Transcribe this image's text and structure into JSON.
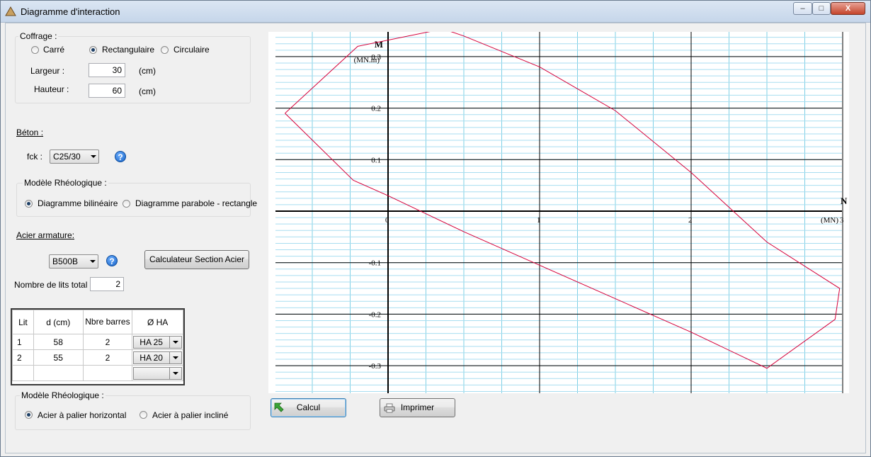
{
  "window": {
    "title": "Diagramme d'interaction",
    "controls": {
      "minimize": "–",
      "maximize": "□",
      "close": "X"
    }
  },
  "coffrage": {
    "legend": "Coffrage :",
    "shapes": [
      {
        "label": "Carré",
        "selected": false
      },
      {
        "label": "Rectangulaire",
        "selected": true
      },
      {
        "label": "Circulaire",
        "selected": false
      }
    ],
    "largeur": {
      "label": "Largeur :",
      "value": "30",
      "unit": "(cm)"
    },
    "hauteur": {
      "label": "Hauteur :",
      "value": "60",
      "unit": "(cm)"
    }
  },
  "beton": {
    "heading": "Béton :",
    "fck_label": "fck :",
    "fck_value": "C25/30",
    "help_icon": "?"
  },
  "modele_beton": {
    "legend": "Modèle Rhéologique :",
    "options": [
      {
        "label": "Diagramme bilinéaire",
        "selected": true
      },
      {
        "label": "Diagramme parabole - rectangle",
        "selected": false
      }
    ]
  },
  "acier": {
    "heading": "Acier armature:",
    "grade": "B500B",
    "help_icon": "?",
    "calc_button": "Calculateur Section Acier",
    "nb_lits_label": "Nombre de lits total :",
    "nb_lits_value": "2"
  },
  "lits_table": {
    "headers": [
      "Lit",
      "d (cm)",
      "Nbre barres",
      "Ø HA"
    ],
    "rows": [
      {
        "lit": "1",
        "d": "58",
        "nb": "2",
        "ha": "HA 25"
      },
      {
        "lit": "2",
        "d": "55",
        "nb": "2",
        "ha": "HA 20"
      },
      {
        "lit": "",
        "d": "",
        "nb": "",
        "ha": ""
      }
    ]
  },
  "modele_acier": {
    "legend": "Modèle Rhéologique :",
    "options": [
      {
        "label": "Acier à palier horizontal",
        "selected": true
      },
      {
        "label": "Acier à palier incliné",
        "selected": false
      }
    ]
  },
  "actions": {
    "calcul": "Calcul",
    "imprimer": "Imprimer"
  },
  "chart_data": {
    "type": "line",
    "xlabel": "N",
    "xunit": "(MN)",
    "ylabel": "M",
    "yunit": "(MN.m)",
    "xlim": [
      -0.75,
      3.0
    ],
    "ylim": [
      -0.34,
      0.35
    ],
    "xticks": [
      "0",
      "1",
      "2",
      "3"
    ],
    "yticks": [
      "0.3",
      "0.2",
      "0.1",
      "-0.1",
      "-0.2",
      "-0.3"
    ],
    "grid": true,
    "line_color": "#d6003a",
    "series": [
      {
        "x": [
          -0.68,
          -0.2,
          0.3,
          0.4,
          0.5,
          1.0,
          1.5,
          2.0,
          2.5,
          2.98,
          2.95,
          2.5,
          2.0,
          1.5,
          1.0,
          0.5,
          0.0,
          -0.23,
          -0.68
        ],
        "y": [
          0.19,
          0.32,
          0.35,
          0.35,
          0.34,
          0.28,
          0.195,
          0.075,
          -0.06,
          -0.15,
          -0.21,
          -0.305,
          -0.235,
          -0.17,
          -0.105,
          -0.04,
          0.03,
          0.06,
          0.19
        ]
      }
    ]
  }
}
